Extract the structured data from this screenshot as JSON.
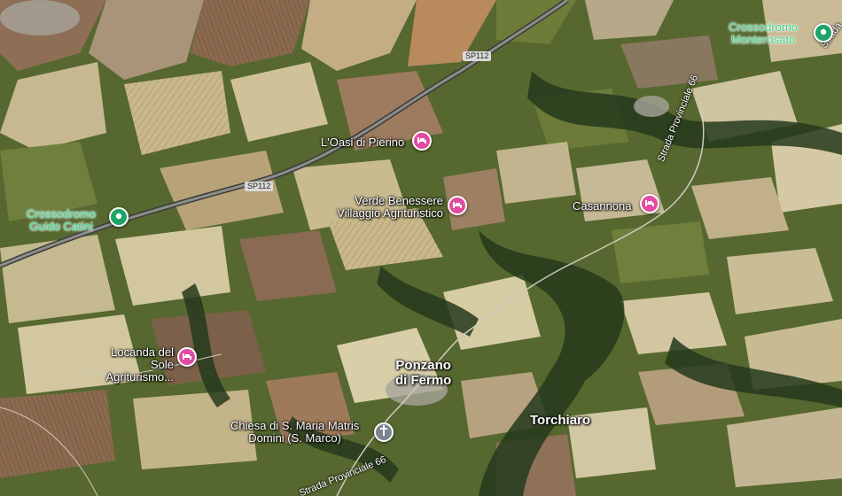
{
  "places": {
    "crossodromo_monterosato": "Crossodromo\nMonterosato",
    "crossodromo_guido_catini": "Crossodromo\nGuido Catini",
    "oasi_di_pierino": "L'Oasi di Pierino",
    "verde_benessere": "Verde Benessere\nVillaggio Agrituristico",
    "casannona": "Casannona",
    "locanda_del_sole": "Locanda del\nSole Agriturismo...",
    "ponzano_di_fermo": "Ponzano\ndi Fermo",
    "chiesa": "Chiesa di S. Maria Matris\nDomini (S. Marco)",
    "torchiaro": "Torchiaro"
  },
  "roads": {
    "sp112_top": "SP112",
    "sp112_mid": "SP112",
    "strada_provinciale_66_right": "Strada Provinciale 66",
    "strada_provinciale_66_bottom": "Strada Provinciale 66",
    "strada_top_right": "Strada"
  },
  "icons": {
    "hotel": "hotel-icon",
    "sport": "sports-venue-icon",
    "church": "church-icon"
  },
  "colors": {
    "hotel_pin": "#e14ba0",
    "sport_pin": "#1ea467",
    "sport_label": "#3fd18f",
    "church_pin": "#7a8590"
  }
}
